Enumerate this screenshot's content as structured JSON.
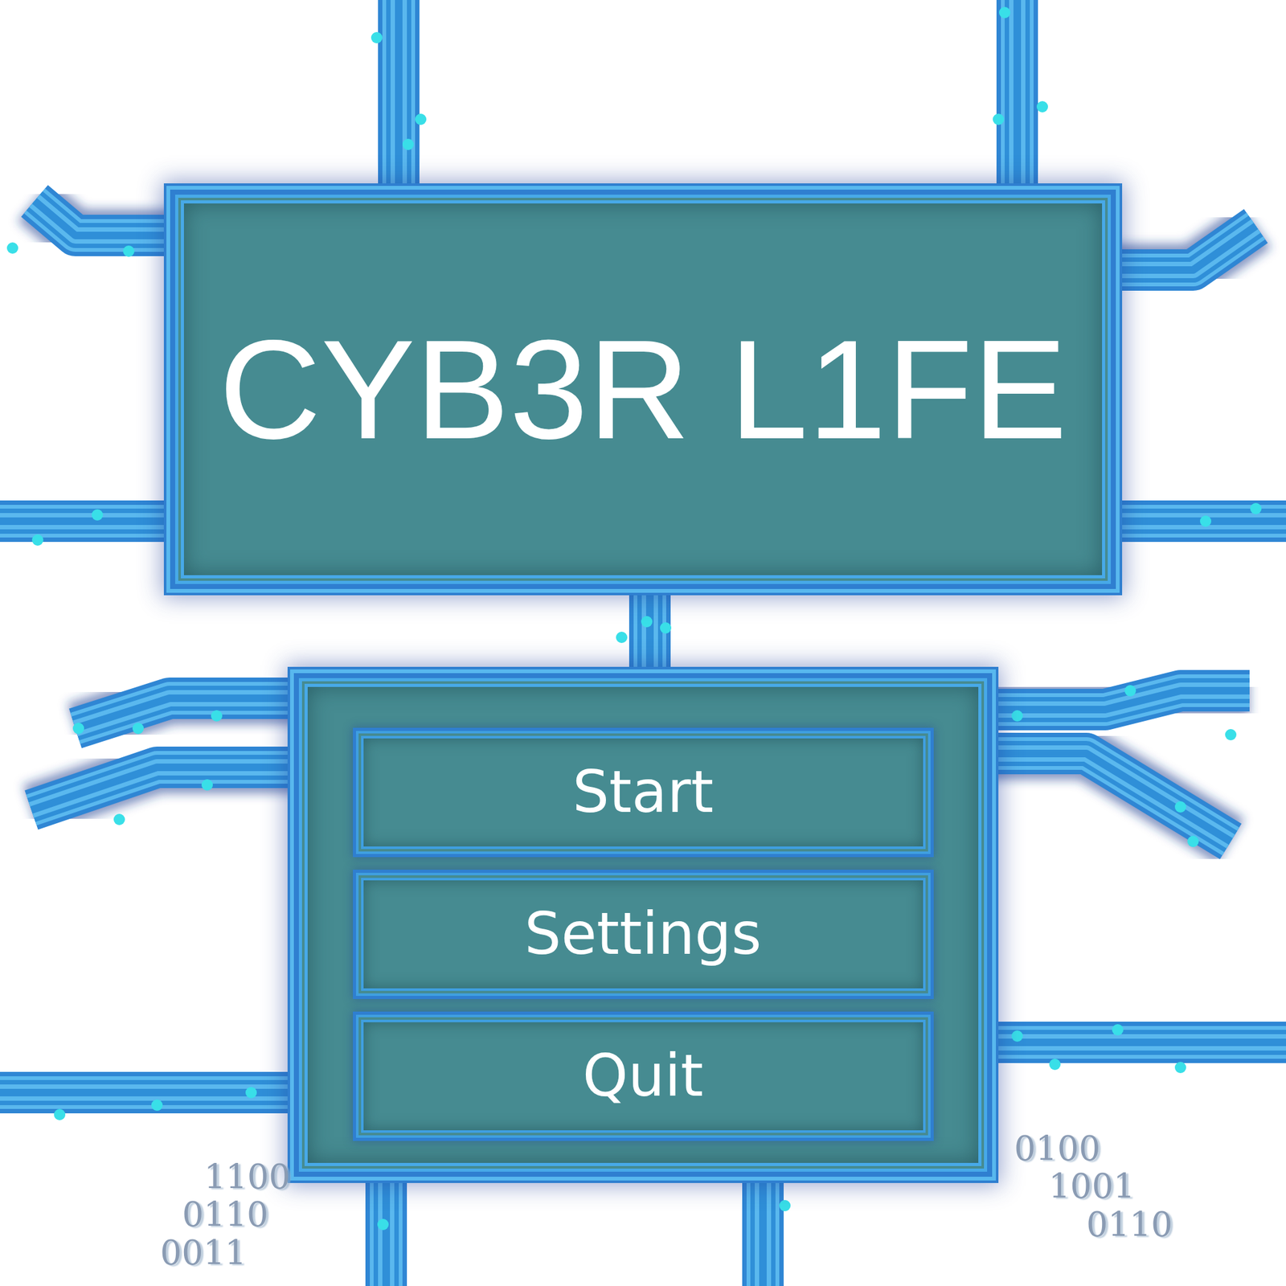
{
  "title": "CYB3R L1FE",
  "menu": [
    {
      "label": "Start"
    },
    {
      "label": "Settings"
    },
    {
      "label": "Quit"
    }
  ],
  "binary": {
    "left": [
      "1100",
      "0110",
      "0011"
    ],
    "right": [
      "0100",
      "1001",
      "0110"
    ]
  }
}
